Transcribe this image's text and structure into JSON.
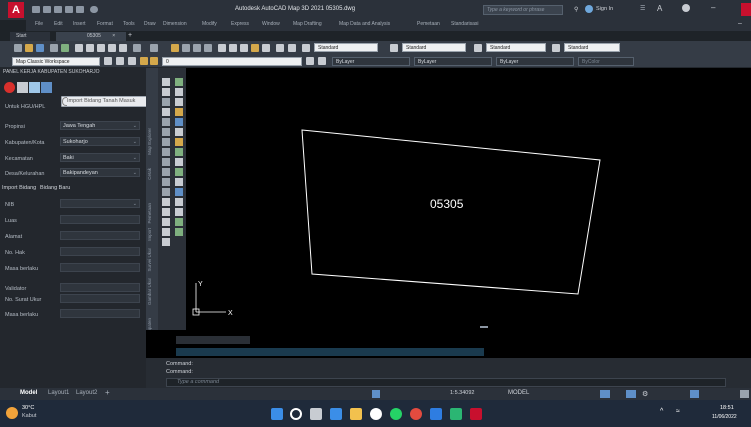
{
  "app": {
    "title": "Autodesk AutoCAD Map 3D 2021   05305.dwg",
    "search_placeholder": "Type a keyword or phrase",
    "sign_in": "Sign In",
    "logo": "A",
    "accent": "#c8102e"
  },
  "menu": [
    "File",
    "Edit",
    "Insert",
    "Format",
    "Tools",
    "Draw",
    "Dimension",
    "Modify",
    "Express",
    "Window",
    "Map Drafting",
    "Map Data and Analysis",
    "Pemetaan",
    "Standarisasi"
  ],
  "tabs": [
    {
      "label": "Start"
    },
    {
      "label": "05305"
    }
  ],
  "toolbar": {
    "text_style": "Standard",
    "dim_style": "Standard",
    "table_style": "Standard",
    "mleader_style": "Standard",
    "workspace": "Map Classic Workspace",
    "layer": "0",
    "color": "ByLayer",
    "linetype": "ByLayer",
    "lineweight": "ByLayer",
    "plotstyle": "ByColor"
  },
  "panel": {
    "title": "PANEL KERJA KABUPATEN SUKOHARJO",
    "mode_label": "Untuk HGU/HPL",
    "import_button": "Import Bidang Tanah Masuk",
    "provinsi_label": "Propinsi",
    "provinsi_value": "Jawa Tengah",
    "kabupaten_label": "Kabupaten/Kota",
    "kabupaten_value": "Sukoharjo",
    "kecamatan_label": "Kecamatan",
    "kecamatan_value": "Baki",
    "desa_label": "Desa/Kelurahan",
    "desa_value": "Bakipandeyan",
    "import_label": "Import Bidang",
    "bidang_baru": "Bidang Baru",
    "nib_label": "NIB",
    "luas_label": "Luas",
    "alamat_label": "Alamat",
    "nohak_label": "No. Hak",
    "masa_label": "Masa berlaku",
    "validator_label": "Validator",
    "nosu_label": "No. Surat Ukur",
    "masa2_label": "Masa berlaku"
  },
  "side_tabs": [
    "Map Explorer",
    "Pemetaan",
    "Cetak",
    "Import",
    "Survei Ukur",
    "Gambar Ukur",
    "Kabupaten"
  ],
  "drawing": {
    "parcel_label": "05305",
    "ucs_x": "X",
    "ucs_y": "Y"
  },
  "command": {
    "line1": "Command:",
    "line2": "Command:",
    "placeholder": "Type a command"
  },
  "layout_tabs": [
    "Model",
    "Layout1",
    "Layout2"
  ],
  "status": {
    "model": "MODEL",
    "scale": "1:5.34092"
  },
  "taskbar": {
    "temp": "30°C",
    "weather": "Kabut",
    "time": "18:51",
    "date": "11/06/2022"
  }
}
